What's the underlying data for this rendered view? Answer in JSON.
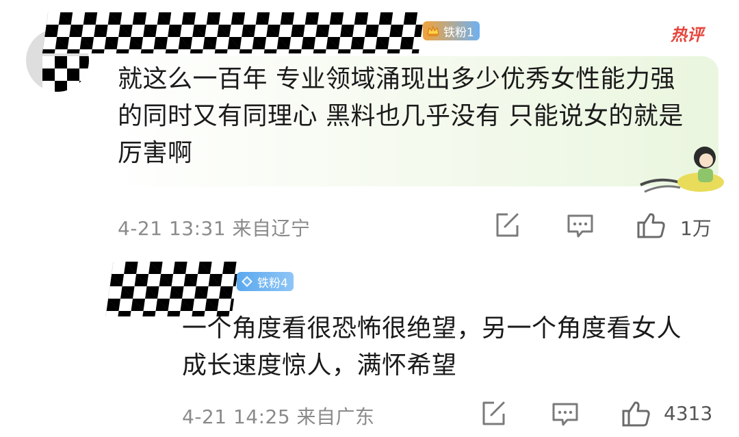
{
  "comments": [
    {
      "badge_label": "铁粉1",
      "tag": "热评",
      "content": "就这么一百年 专业领域涌现出多少优秀女性能力强的同时又有同理心  黑料也几乎没有 只能说女的就是厉害啊",
      "time": "4-21 13:31",
      "location": "来自辽宁",
      "likes": "1万",
      "icons": {
        "share": "share-edit-icon",
        "comment": "comment-icon",
        "like": "thumbs-up-icon"
      }
    },
    {
      "badge_label": "铁粉4",
      "content": "一个角度看很恐怖很绝望，另一个角度看女人成长速度惊人，满怀希望",
      "time": "4-21 14:25",
      "location": "来自广东",
      "likes": "4313",
      "icons": {
        "share": "share-edit-icon",
        "comment": "comment-icon",
        "like": "thumbs-up-icon"
      }
    }
  ],
  "colors": {
    "hot_tag": "#e6453d",
    "meta_text": "#8a8a8a",
    "badge_gold": "#f2a23a",
    "badge_blue": "#5aa8ee"
  }
}
